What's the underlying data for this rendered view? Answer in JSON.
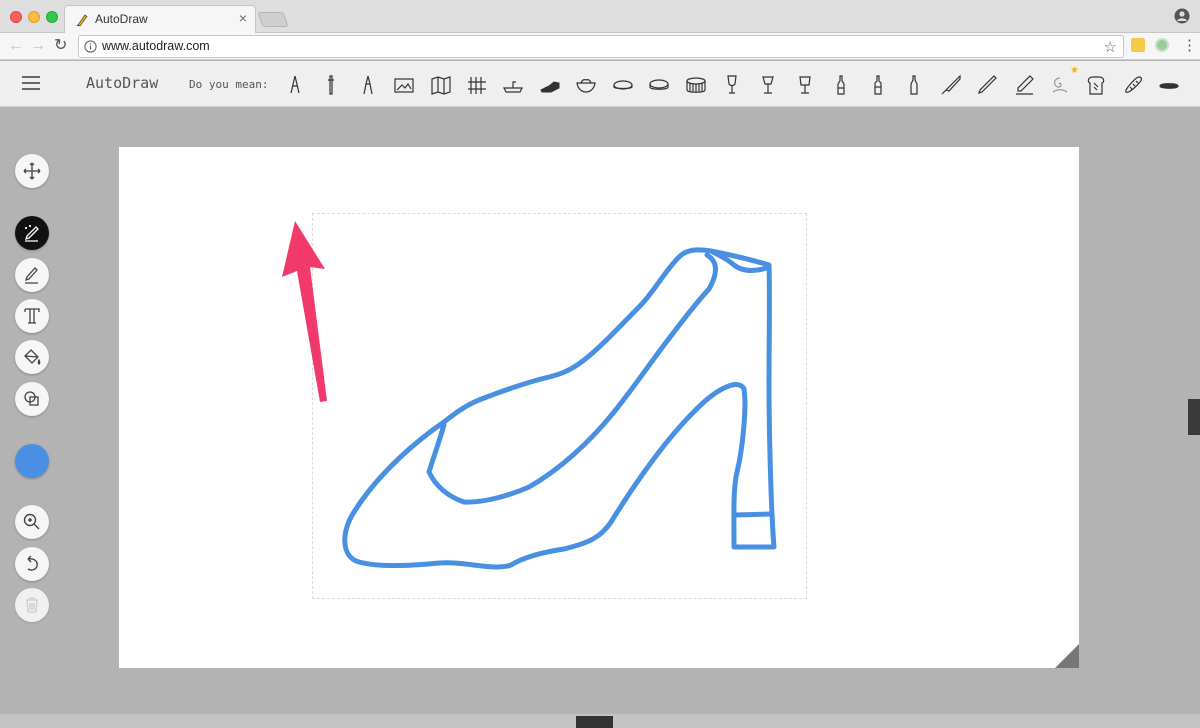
{
  "browser": {
    "tab_title": "AutoDraw",
    "tab_close": "×",
    "url": "www.autodraw.com",
    "nav": {
      "back": "←",
      "forward": "→",
      "reload": "↻"
    },
    "star": "☆",
    "menu": "⋮"
  },
  "app": {
    "title": "AutoDraw",
    "suggest_label": "Do you mean:",
    "suggestions": [
      "tweezers-icon",
      "sword-icon",
      "pliers-icon",
      "picture-icon",
      "map-icon",
      "bridge-icon",
      "sink-icon",
      "shoe-icon",
      "bowl-icon",
      "ring-icon",
      "cookie-icon",
      "drum-icon",
      "wine-glass-icon",
      "goblet-icon",
      "glass-icon",
      "bottle-icon",
      "bottle-icon",
      "bottle-icon",
      "knife-icon",
      "pencil-icon",
      "pen-icon",
      "snail-icon",
      "bread-icon",
      "baguette-icon",
      "hot-dog-icon"
    ],
    "new_marker": "★"
  },
  "tools": [
    {
      "name": "move-tool",
      "icon": "move-icon"
    },
    {
      "name": "autodraw-tool",
      "icon": "magic-pencil-icon",
      "active": true
    },
    {
      "name": "draw-tool",
      "icon": "pencil-icon"
    },
    {
      "name": "type-tool",
      "icon": "text-icon",
      "glyph": "T"
    },
    {
      "name": "fill-tool",
      "icon": "fill-bucket-icon"
    },
    {
      "name": "shape-tool",
      "icon": "shapes-icon"
    },
    {
      "name": "color-tool",
      "icon": "color-swatch",
      "color": "#4a90e2"
    },
    {
      "name": "zoom-tool",
      "icon": "zoom-icon"
    },
    {
      "name": "undo-tool",
      "icon": "undo-icon"
    },
    {
      "name": "delete-tool",
      "icon": "trash-icon",
      "disabled": true
    }
  ],
  "colors": {
    "stroke": "#4a90e2",
    "annotation_arrow": "#f2396b"
  }
}
